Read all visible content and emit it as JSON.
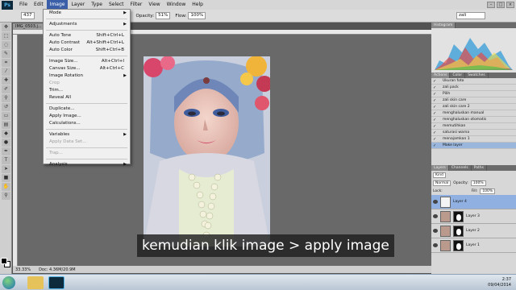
{
  "app": {
    "logo": "Ps",
    "doc_tab": "IMG_0503.j..."
  },
  "menubar": [
    "File",
    "Edit",
    "Image",
    "Layer",
    "Type",
    "Select",
    "Filter",
    "View",
    "Window",
    "Help"
  ],
  "options": {
    "size": "437",
    "opacity_label": "Opacity:",
    "opacity": "51%",
    "flow_label": "Flow:",
    "flow": "100%",
    "search": "zali"
  },
  "image_menu": {
    "mode": "Mode",
    "adjustments": "Adjustments",
    "auto_tone": "Auto Tone",
    "auto_tone_sc": "Shift+Ctrl+L",
    "auto_contrast": "Auto Contrast",
    "auto_contrast_sc": "Alt+Shift+Ctrl+L",
    "auto_color": "Auto Color",
    "auto_color_sc": "Shift+Ctrl+B",
    "image_size": "Image Size...",
    "image_size_sc": "Alt+Ctrl+I",
    "canvas_size": "Canvas Size...",
    "canvas_size_sc": "Alt+Ctrl+C",
    "image_rotation": "Image Rotation",
    "crop": "Crop",
    "trim": "Trim...",
    "reveal_all": "Reveal All",
    "duplicate": "Duplicate...",
    "apply_image": "Apply Image...",
    "calculations": "Calculations...",
    "variables": "Variables",
    "apply_data_set": "Apply Data Set...",
    "trap": "Trap...",
    "analysis": "Analysis"
  },
  "status": {
    "zoom": "33.33%",
    "doc": "Doc: 4.36M/20.9M"
  },
  "panels": {
    "histogram_tab": "Histogram",
    "tabs": [
      "Actions",
      "Color",
      "Swatches"
    ],
    "actions": [
      "Ukuran foto",
      "zali pack",
      "Pilih",
      "zali skin care",
      "zali skin care 2",
      "menghaluskan manual",
      "menghaluskan otomatis",
      "memutihkan",
      "saturasi warna",
      "menajamkan 1",
      "Make layer"
    ],
    "layer_tabs": [
      "Layers",
      "Channels",
      "Paths"
    ],
    "kind": "Kind",
    "blend": "Normal",
    "opacity_label": "Opacity:",
    "opacity": "100%",
    "lock_label": "Lock:",
    "fill_label": "Fill:",
    "fill": "100%",
    "layers": [
      "Layer 4",
      "Layer 3",
      "Layer 2",
      "Layer 1"
    ]
  },
  "subtitle": "kemudian klik image > apply image",
  "clock": {
    "time": "2:37",
    "date": "09/04/2014"
  }
}
